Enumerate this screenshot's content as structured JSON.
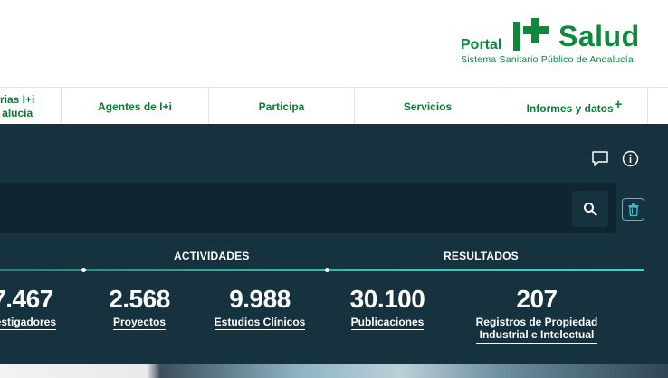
{
  "header": {
    "logo": {
      "portal": "Portal",
      "salud": "Salud",
      "subtitle": "Sistema Sanitario Público de Andalucía",
      "brand_color": "#0a8a3a"
    }
  },
  "nav": {
    "items": [
      {
        "label_line1": "rias I+i",
        "label_line2": "alucía"
      },
      {
        "label": "Agentes de I+i"
      },
      {
        "label": "Participa"
      },
      {
        "label": "Servicios"
      },
      {
        "label": "Informes y datos",
        "suffix": "+"
      }
    ]
  },
  "panel": {
    "bg_color": "#16323f",
    "icons": [
      "comment-icon",
      "info-icon",
      "search-icon",
      "trash-icon"
    ],
    "sections": {
      "actividades": "ACTIVIDADES",
      "resultados": "RESULTADOS"
    },
    "stats": [
      {
        "value": "7.467",
        "label": "vestigadores"
      },
      {
        "value": "2.568",
        "label": "Proyectos"
      },
      {
        "value": "9.988",
        "label": "Estudios Clínicos"
      },
      {
        "value": "30.100",
        "label": "Publicaciones"
      },
      {
        "value": "207",
        "label_line1": "Registros de Propiedad",
        "label_line2": "Industrial e Intelectual"
      }
    ]
  }
}
